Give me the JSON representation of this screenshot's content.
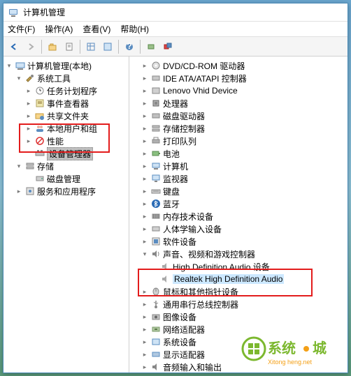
{
  "title": "计算机管理",
  "menu": {
    "file": "文件(F)",
    "action": "操作(A)",
    "view": "查看(V)",
    "help": "帮助(H)"
  },
  "left": {
    "root": "计算机管理(本地)",
    "systools": "系统工具",
    "task": "任务计划程序",
    "event": "事件查看器",
    "shared": "共享文件夹",
    "users": "本地用户和组",
    "perf": "性能",
    "devmgr": "设备管理器",
    "storage": "存储",
    "disk": "磁盘管理",
    "services": "服务和应用程序"
  },
  "right": {
    "dvd": "DVD/CD-ROM 驱动器",
    "ide": "IDE ATA/ATAPI 控制器",
    "lenovo": "Lenovo Vhid Device",
    "cpu": "处理器",
    "diskdrv": "磁盘驱动器",
    "storctrl": "存储控制器",
    "printq": "打印队列",
    "battery": "电池",
    "computer": "计算机",
    "monitor": "监视器",
    "keyboard": "键盘",
    "bt": "蓝牙",
    "memtech": "内存技术设备",
    "hid": "人体学输入设备",
    "software": "软件设备",
    "sound": "声音、视频和游戏控制器",
    "hda": "High Definition Audio 设备",
    "realtek": "Realtek High Definition Audio",
    "mouse": "鼠标和其他指针设备",
    "usb": "通用串行总线控制器",
    "imaging": "图像设备",
    "net": "网络适配器",
    "sysdev": "系统设备",
    "display": "显示适配器",
    "audioio": "音频输入和输出"
  },
  "watermark": {
    "main": "系统",
    "city": "城",
    "sub": "Xitong heng.net"
  }
}
